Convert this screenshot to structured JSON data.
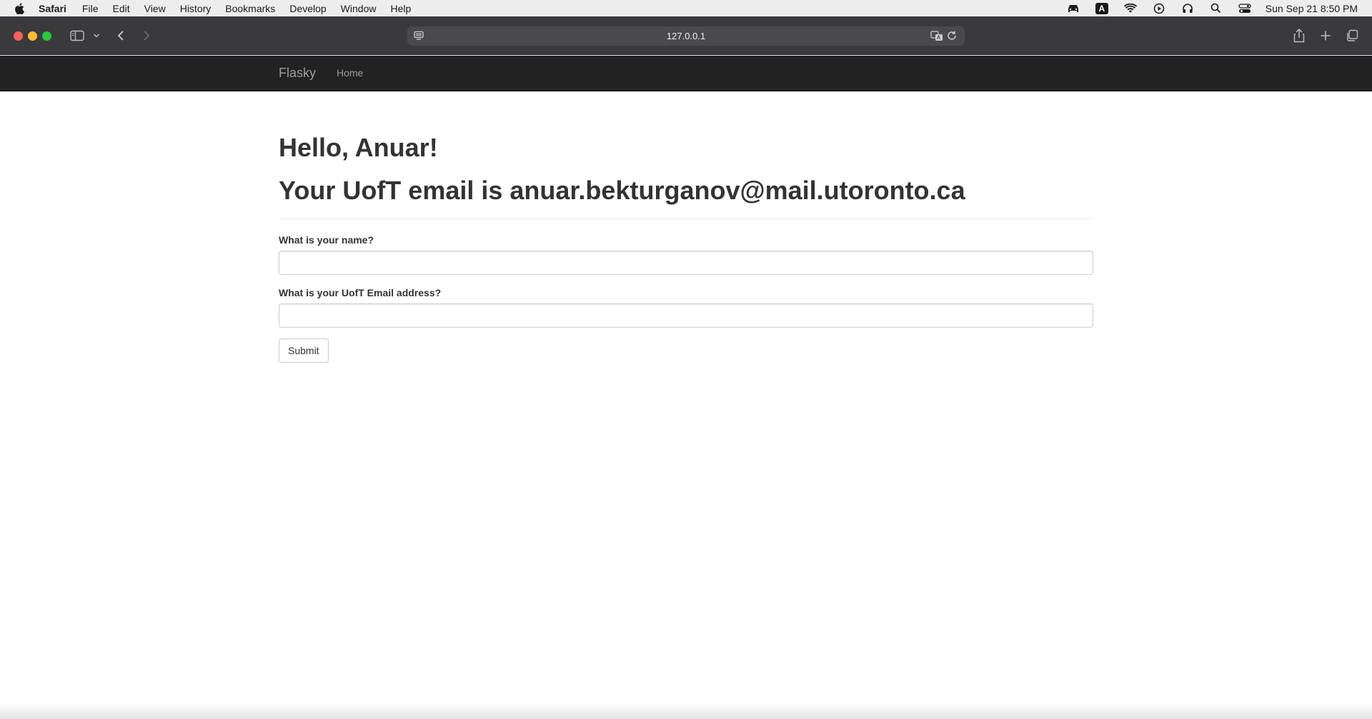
{
  "menubar": {
    "app": "Safari",
    "items": [
      "File",
      "Edit",
      "View",
      "History",
      "Bookmarks",
      "Develop",
      "Window",
      "Help"
    ],
    "input_indicator": "A",
    "clock": "Sun Sep 21  8:50 PM"
  },
  "browser": {
    "url": "127.0.0.1"
  },
  "navbar": {
    "brand": "Flasky",
    "links": [
      "Home"
    ]
  },
  "main": {
    "greeting": "Hello, Anuar!",
    "email_line": "Your UofT email is anuar.bekturganov@mail.utoronto.ca",
    "form": {
      "name_label": "What is your name?",
      "name_value": "",
      "email_label": "What is your UofT Email address?",
      "email_value": "",
      "submit_label": "Submit"
    }
  },
  "colors": {
    "navbar_bg": "#222222",
    "navbar_text": "#9d9d9d",
    "heading_text": "#333333",
    "toolbar_bg": "#3a3a3c"
  }
}
